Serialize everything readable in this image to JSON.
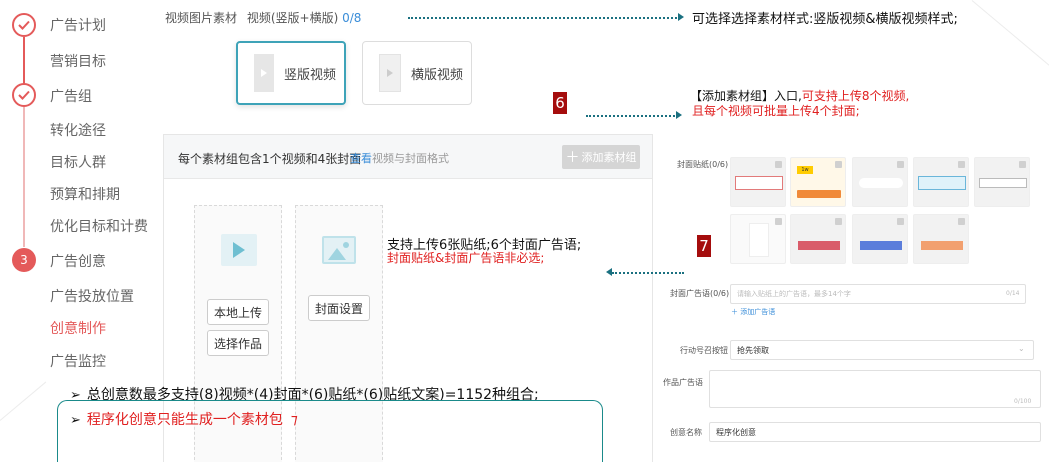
{
  "sidebar": {
    "steps": [
      {
        "label": "广告计划",
        "state": "done"
      },
      {
        "label": "营销目标",
        "state": "sub"
      },
      {
        "label": "广告组",
        "state": "done"
      },
      {
        "label": "转化途径",
        "state": "sub"
      },
      {
        "label": "目标人群",
        "state": "sub"
      },
      {
        "label": "预算和排期",
        "state": "sub"
      },
      {
        "label": "优化目标和计费",
        "state": "sub"
      },
      {
        "label": "广告创意",
        "state": "active"
      },
      {
        "label": "广告投放位置",
        "state": "sub"
      },
      {
        "label": "创意制作",
        "state": "current"
      },
      {
        "label": "广告监控",
        "state": "sub"
      }
    ],
    "active_step_number": "3"
  },
  "material": {
    "title": "视频图片素材",
    "spec": "视频(竖版+横版)",
    "count": "0/8",
    "vertical_label": "竖版视频",
    "horizontal_label": "横版视频"
  },
  "group": {
    "desc": "每个素材组包含1个视频和4张封面",
    "link_prefix": "查看",
    "link_suffix": "视频与封面格式",
    "add_button": "添加素材组",
    "local_upload": "本地上传",
    "choose_work": "选择作品",
    "cover_setting": "封面设置"
  },
  "right_panel": {
    "sticker_label": "封面贴纸(0/6)",
    "cover_ad_label": "封面广告语(0/6)",
    "cover_ad_placeholder": "请输入贴纸上的广告语，最多14个字",
    "cover_ad_count": "0/14",
    "add_ad_text": "添加广告语",
    "cta_label": "行动号召按钮",
    "cta_value": "抢先领取",
    "creative_ad_label": "作品广告语",
    "creative_ad_count": "0/100",
    "creative_name_label": "创意名称",
    "creative_name_value": "程序化创意",
    "sticker_colors": [
      "#d95c6a",
      "#5b7ddb",
      "#f2a06f"
    ],
    "sticker_tag": "1w"
  },
  "annotations": {
    "top": "可选择选择素材样式:竖版视频&横版视频样式;",
    "num6": "6",
    "add_group_black": "【添加素材组】入口,",
    "add_group_red1": "可支持上传8个视频,",
    "add_group_red2": "且每个视频可批量上传4个封面;",
    "num7": "7",
    "sticker_black": "支持上传6张贴纸;6个封面广告语;",
    "sticker_red": "封面贴纸&封面广告语非必选;",
    "bottom1": "总创意数最多支持(8)视频*(4)封面*(6)贴纸*(6)贴纸文案)=1152种组合;",
    "bottom2": "程序化创意只能生成一个素材包",
    "bullet": "➢"
  }
}
